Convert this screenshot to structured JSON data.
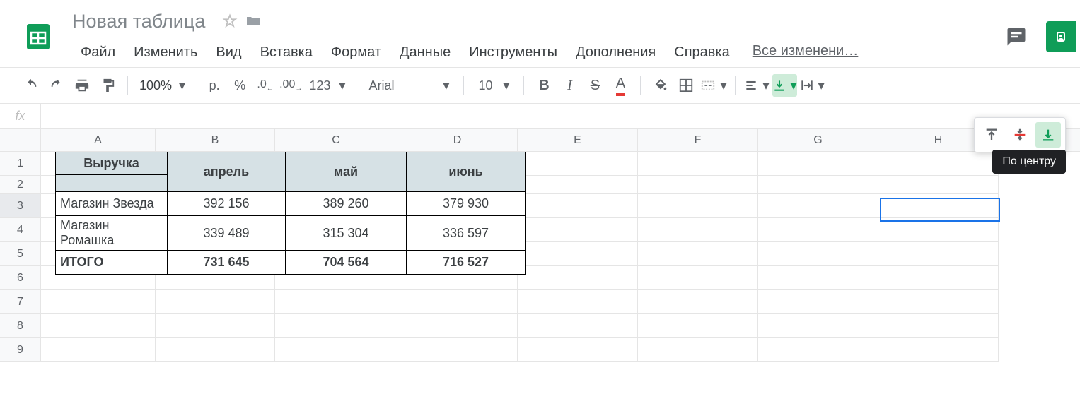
{
  "doc": {
    "title": "Новая таблица"
  },
  "menus": [
    "Файл",
    "Изменить",
    "Вид",
    "Вставка",
    "Формат",
    "Данные",
    "Инструменты",
    "Дополнения",
    "Справка"
  ],
  "changes_link": "Все изменени…",
  "toolbar": {
    "zoom": "100%",
    "currency": "р.",
    "percent": "%",
    "dec_less": ".0",
    "dec_more": ".00",
    "more_fmt": "123",
    "font": "Arial",
    "size": "10"
  },
  "fx": "",
  "cols": {
    "labels": [
      "A",
      "B",
      "C",
      "D",
      "E",
      "F",
      "G",
      "H"
    ],
    "widths": [
      162,
      169,
      173,
      170,
      170,
      170,
      170,
      170
    ]
  },
  "rows": {
    "labels": [
      "1",
      "2",
      "3",
      "4",
      "5",
      "6",
      "7",
      "8",
      "9"
    ],
    "heights": [
      34,
      26,
      34,
      34,
      34,
      34,
      34,
      34,
      34
    ],
    "selected": 3
  },
  "data": {
    "header_a": "Выручка",
    "months": [
      "апрель",
      "май",
      "июнь"
    ],
    "store1_name": "Магазин Звезда",
    "store1_vals": [
      "392 156",
      "389 260",
      "379 930"
    ],
    "store2_name": "Магазин Ромашка",
    "store2_vals": [
      "339 489",
      "315 304",
      "336 597"
    ],
    "total_name": "ИТОГО",
    "total_vals": [
      "731 645",
      "704 564",
      "716 527"
    ]
  },
  "tooltip": "По центру",
  "chart_data": {
    "type": "table",
    "title": "Выручка",
    "columns": [
      "",
      "апрель",
      "май",
      "июнь"
    ],
    "rows": [
      {
        "name": "Магазин Звезда",
        "values": [
          392156,
          389260,
          379930
        ]
      },
      {
        "name": "Магазин Ромашка",
        "values": [
          339489,
          315304,
          336597
        ]
      },
      {
        "name": "ИТОГО",
        "values": [
          731645,
          704564,
          716527
        ]
      }
    ]
  }
}
